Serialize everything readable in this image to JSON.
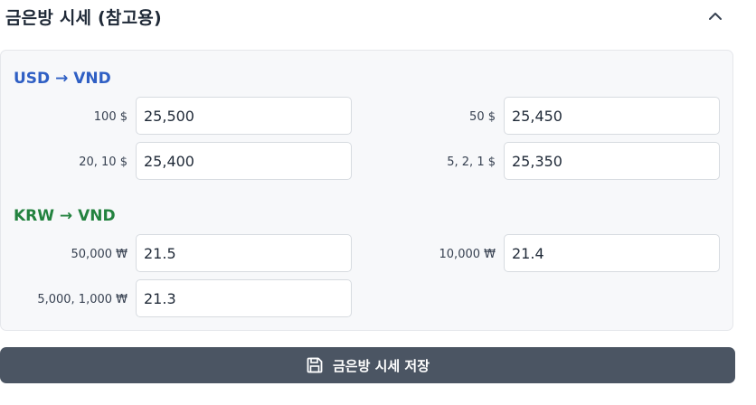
{
  "header": {
    "title": "금은방 시세 (참고용)",
    "collapse_icon": "chevron-up-icon"
  },
  "usd": {
    "title": "USD → VND",
    "title_color": "#2f5fc4",
    "fields": [
      {
        "label": "100 $",
        "value": "25,500"
      },
      {
        "label": "50 $",
        "value": "25,450"
      },
      {
        "label": "20, 10 $",
        "value": "25,400"
      },
      {
        "label": "5, 2, 1 $",
        "value": "25,350"
      }
    ]
  },
  "krw": {
    "title": "KRW → VND",
    "title_color": "#23823f",
    "fields": [
      {
        "label": "50,000 ₩",
        "value": "21.5"
      },
      {
        "label": "10,000 ₩",
        "value": "21.4"
      },
      {
        "label": "5,000, 1,000 ₩",
        "value": "21.3"
      }
    ]
  },
  "save_button": {
    "label": "금은방 시세 저장",
    "icon": "save-icon",
    "color": "#4b5563"
  }
}
